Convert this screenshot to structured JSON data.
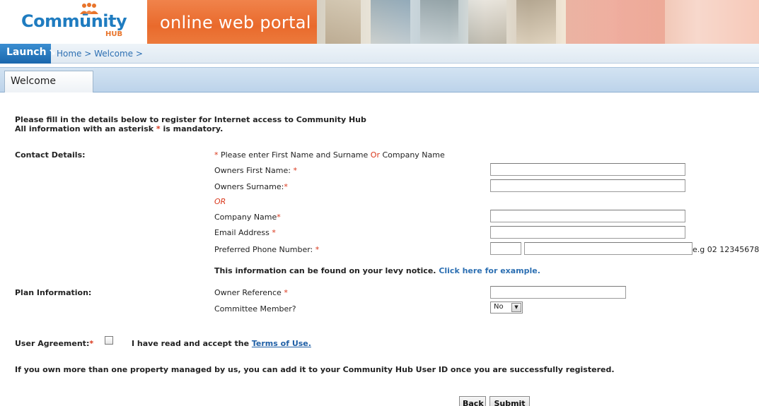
{
  "header": {
    "logo_main": "Commūnity",
    "logo_sub": "HUB",
    "portal_title": "online web portal"
  },
  "nav": {
    "launch_label": "Launch",
    "launch_icon": "arrow-down-right-icon",
    "breadcrumb": "Home > Welcome >"
  },
  "tabs": [
    {
      "label": "Welcome",
      "active": true
    }
  ],
  "intro": {
    "line1": "Please fill in the details below to register for Internet access to Community Hub",
    "line2_pre": "All information with an asterisk ",
    "asterisk": "*",
    "line2_post": " is mandatory."
  },
  "contact": {
    "section_label": "Contact Details:",
    "note_pre": " Please enter First Name and Surname ",
    "note_or": "Or",
    "note_post": " Company Name",
    "first_name_label": "Owners First Name: ",
    "surname_label": "Owners Surname:",
    "or_label": "OR",
    "company_label": "Company Name",
    "email_label": "Email Address ",
    "phone_label": "Preferred Phone Number: ",
    "phone_hint": "e.g 02 12345678",
    "first_name_value": "",
    "surname_value": "",
    "company_value": "",
    "email_value": "",
    "phone_area_value": "",
    "phone_number_value": ""
  },
  "levy": {
    "text": "This information can be found on your levy notice. ",
    "link": "Click here for example."
  },
  "plan": {
    "section_label": "Plan Information:",
    "owner_ref_label": "Owner Reference ",
    "owner_ref_value": "",
    "committee_label": "Committee Member?",
    "committee_value": "No"
  },
  "agreement": {
    "label": "User Agreement:",
    "checked": false,
    "text": "I have read and accept the ",
    "terms_link": "Terms of Use."
  },
  "footer_note": "If you own more than one property managed by us, you can add it to your Community Hub User ID once you are successfully registered.",
  "buttons": {
    "back": "Back",
    "submit": "Submit"
  }
}
